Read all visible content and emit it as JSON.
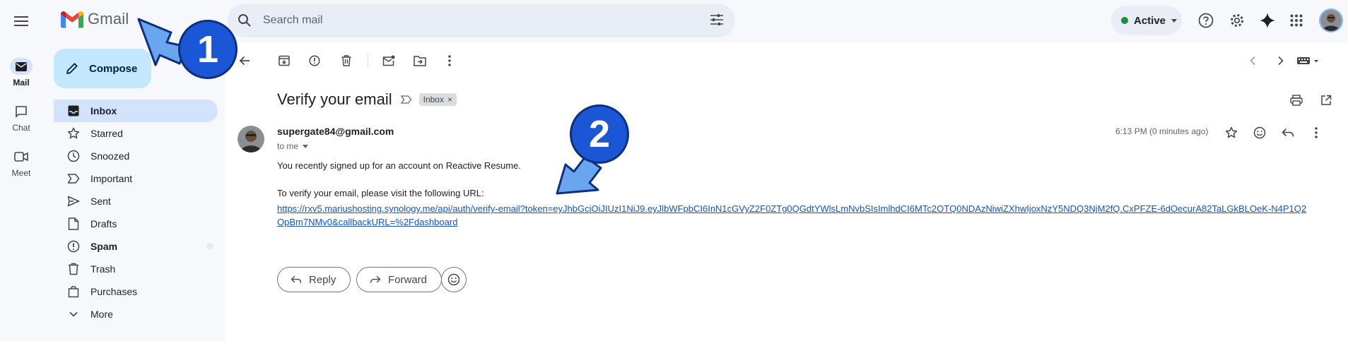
{
  "app": {
    "logo_text": "Gmail"
  },
  "rail": {
    "items": [
      {
        "label": "Mail",
        "icon": "mail-icon",
        "active": true
      },
      {
        "label": "Chat",
        "icon": "chat-icon",
        "active": false
      },
      {
        "label": "Meet",
        "icon": "meet-icon",
        "active": false
      }
    ]
  },
  "sidebar": {
    "compose_label": "Compose",
    "items": [
      {
        "label": "Inbox",
        "icon": "inbox-icon",
        "active": true
      },
      {
        "label": "Starred",
        "icon": "star-icon"
      },
      {
        "label": "Snoozed",
        "icon": "clock-icon"
      },
      {
        "label": "Important",
        "icon": "important-icon"
      },
      {
        "label": "Sent",
        "icon": "send-icon"
      },
      {
        "label": "Drafts",
        "icon": "draft-icon"
      },
      {
        "label": "Spam",
        "icon": "spam-icon",
        "bold": true
      },
      {
        "label": "Trash",
        "icon": "trash-icon"
      },
      {
        "label": "Purchases",
        "icon": "purchases-icon"
      },
      {
        "label": "More",
        "icon": "chevron-down-icon"
      }
    ]
  },
  "search": {
    "placeholder": "Search mail"
  },
  "header": {
    "status_label": "Active",
    "status_color": "#1e8e3e"
  },
  "email": {
    "subject": "Verify your email",
    "label_chip": "Inbox",
    "label_chip_close": "×",
    "sender": "supergate84@gmail.com",
    "recipient": "to me",
    "time": "6:13 PM (0 minutes ago)",
    "body_line1": "You recently signed up for an account on Reactive Resume.",
    "body_line2": "To verify your email, please visit the following URL:",
    "link": "https://rxv5.mariushosting.synology.me/api/auth/verify-email?token=eyJhbGciOiJIUzI1NiJ9.eyJlbWFpbCI6InN1cGVyZ2F0ZTg0QGdtYWlsLmNvbSIsImlhdCI6MTc2OTQ0NDAzNiwiZXhwIjoxNzY5NDQ3NjM2fQ.CxPFZE-6dOecurA82TaLGkBLOeK-N4P1Q2OpBm7NMv0&callbackURL=%2Fdashboard"
  },
  "actions": {
    "reply_label": "Reply",
    "forward_label": "Forward"
  },
  "annotations": {
    "marker1": "1",
    "marker2": "2",
    "marker_color": "#1a56d6",
    "arrow_color": "#6aa6f0"
  }
}
